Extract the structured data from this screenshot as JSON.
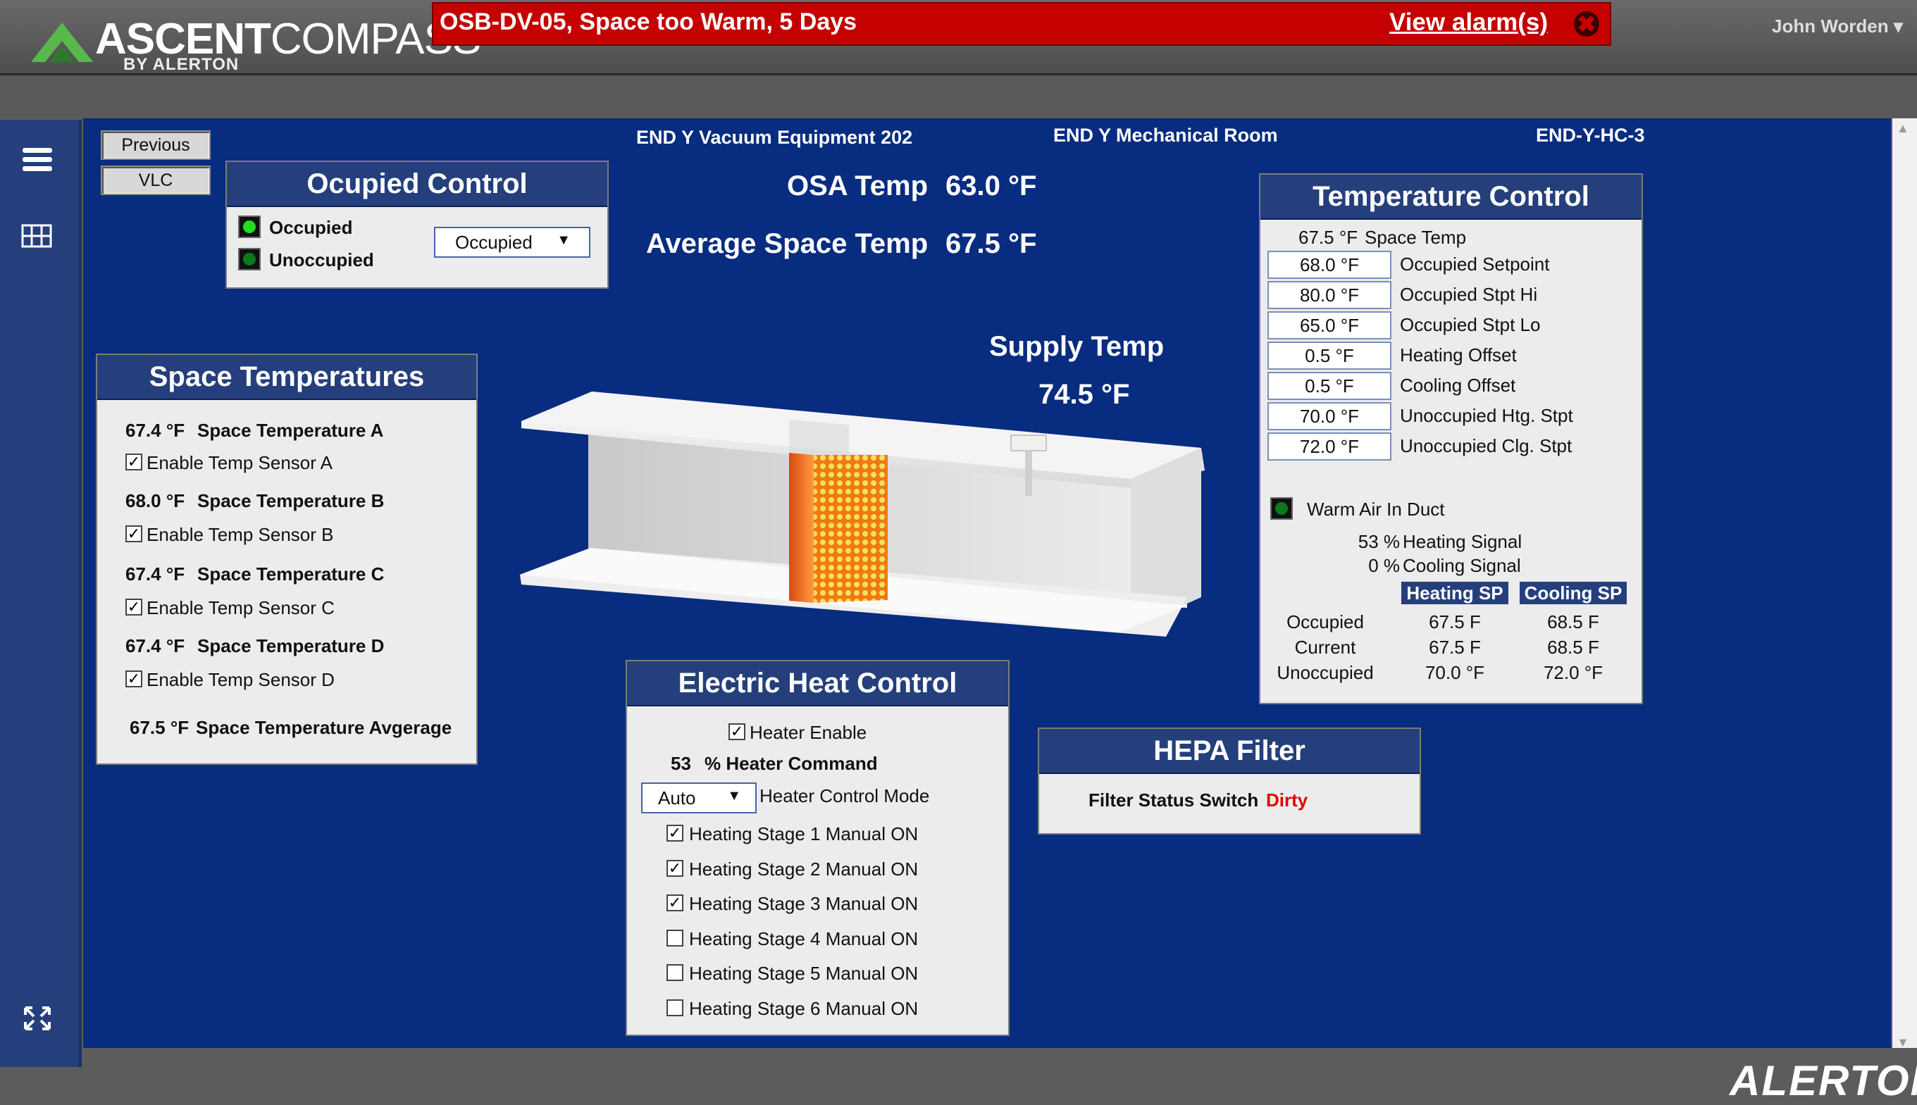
{
  "header": {
    "logo_bold": "ASCENT",
    "logo_light": "COMPASS",
    "logo_sub": "BY ALERTON",
    "alarm_text": "OSB-DV-05, Space too Warm, 5 Days",
    "alarm_link": "View alarm(s)",
    "user": "John Worden ▾"
  },
  "footer": {
    "brand": "ALERTON"
  },
  "nav_buttons": {
    "previous": "Previous",
    "vlc": "VLC"
  },
  "location": {
    "equipment": "END Y Vacuum Equipment 202",
    "room": "END Y Mechanical Room",
    "device": "END-Y-HC-3"
  },
  "readouts": {
    "osa_label": "OSA Temp",
    "osa_value": "63.0 °F",
    "avg_label": "Average Space Temp",
    "avg_value": "67.5 °F",
    "supply_label": "Supply Temp",
    "supply_value": "74.5 °F"
  },
  "occupied_control": {
    "title": "Ocupied Control",
    "occupied": "Occupied",
    "unoccupied": "Unoccupied",
    "mode": "Occupied"
  },
  "space_temps": {
    "title": "Space Temperatures",
    "a_value": "67.4 °F",
    "a_label": "Space Temperature A",
    "a_enable": "Enable Temp Sensor A",
    "b_value": "68.0 °F",
    "b_label": "Space Temperature B",
    "b_enable": "Enable Temp Sensor B",
    "c_value": "67.4 °F",
    "c_label": "Space Temperature C",
    "c_enable": "Enable Temp Sensor C",
    "d_value": "67.4 °F",
    "d_label": "Space Temperature D",
    "d_enable": "Enable Temp Sensor D",
    "avg_value": "67.5 °F",
    "avg_label": "Space Temperature Avgerage"
  },
  "temp_control": {
    "title": "Temperature Control",
    "space_value": "67.5 °F",
    "space_label": "Space Temp",
    "rows": [
      {
        "value": "68.0 °F",
        "label": "Occupied Setpoint"
      },
      {
        "value": "80.0 °F",
        "label": "Occupied Stpt Hi"
      },
      {
        "value": "65.0 °F",
        "label": "Occupied Stpt Lo"
      },
      {
        "value": "0.5 °F",
        "label": "Heating Offset"
      },
      {
        "value": "0.5 °F",
        "label": "Cooling Offset"
      },
      {
        "value": "70.0 °F",
        "label": "Unoccupied Htg. Stpt"
      },
      {
        "value": "72.0 °F",
        "label": "Unoccupied Clg. Stpt"
      }
    ],
    "warm_air": "Warm Air In Duct",
    "heating_pct": "53 %",
    "heating_label": "Heating Signal",
    "cooling_pct": "0 %",
    "cooling_label": "Cooling Signal",
    "heating_sp": "Heating SP",
    "cooling_sp": "Cooling SP",
    "sp_rows": [
      {
        "label": "Occupied",
        "heat": "67.5 F",
        "cool": "68.5 F"
      },
      {
        "label": "Current",
        "heat": "67.5 F",
        "cool": "68.5 F"
      },
      {
        "label": "Unoccupied",
        "heat": "70.0 °F",
        "cool": "72.0 °F"
      }
    ]
  },
  "electric_heat": {
    "title": "Electric Heat Control",
    "enable": "Heater Enable",
    "command_value": "53",
    "command_label": "% Heater Command",
    "mode_value": "Auto",
    "mode_label": "Heater Control Mode",
    "stages": [
      {
        "label": "Heating Stage 1 Manual ON",
        "checked": true
      },
      {
        "label": "Heating Stage 2 Manual ON",
        "checked": true
      },
      {
        "label": "Heating Stage 3 Manual ON",
        "checked": true
      },
      {
        "label": "Heating Stage 4 Manual ON",
        "checked": false
      },
      {
        "label": "Heating Stage 5 Manual ON",
        "checked": false
      },
      {
        "label": "Heating Stage 6 Manual ON",
        "checked": false
      }
    ]
  },
  "hepa": {
    "title": "HEPA Filter",
    "label": "Filter Status Switch",
    "status": "Dirty",
    "status_color": "#e00000"
  },
  "colors": {
    "led_on": "#22dd22",
    "led_off": "#0a7a1a",
    "panel_title": "#243f7c",
    "background": "#082c7f"
  }
}
